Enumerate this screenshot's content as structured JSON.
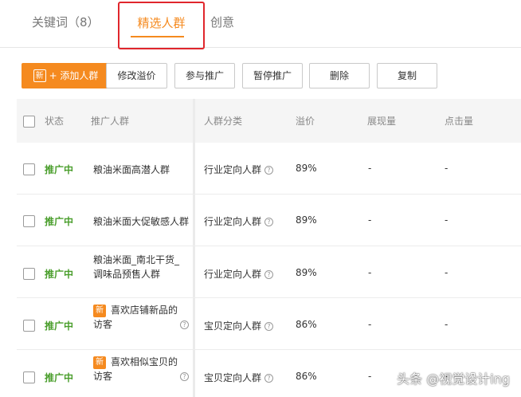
{
  "tabs": [
    {
      "label": "关键词（8）"
    },
    {
      "label": "精选人群"
    },
    {
      "label": "创意"
    }
  ],
  "toolbar": {
    "add_new_tag": "新",
    "add_label": "+ 添加人群",
    "modify_label": "修改溢价",
    "join_label": "参与推广",
    "pause_label": "暂停推广",
    "delete_label": "删除",
    "copy_label": "复制"
  },
  "table": {
    "headers": {
      "status": "状态",
      "crowd": "推广人群",
      "category": "人群分类",
      "premium": "溢价",
      "impressions": "展现量",
      "clicks": "点击量"
    },
    "help_icon": "?",
    "new_badge": "新",
    "rows": [
      {
        "status": "推广中",
        "name": "粮油米面高潜人群",
        "category": "行业定向人群",
        "premium": "89%",
        "impressions": "-",
        "clicks": "-"
      },
      {
        "status": "推广中",
        "name": "粮油米面大促敏感人群",
        "category": "行业定向人群",
        "premium": "89%",
        "impressions": "-",
        "clicks": "-"
      },
      {
        "status": "推广中",
        "name_line1": "粮油米面_南北干货_",
        "name_line2": "调味品预售人群",
        "category": "行业定向人群",
        "premium": "89%",
        "impressions": "-",
        "clicks": "-"
      },
      {
        "status": "推广中",
        "name_line1": "喜欢店铺新品的",
        "name_line2": "访客",
        "category": "宝贝定向人群",
        "premium": "86%",
        "impressions": "-",
        "clicks": "-"
      },
      {
        "status": "推广中",
        "name_line1": "喜欢相似宝贝的",
        "name_line2": "访客",
        "category": "宝贝定向人群",
        "premium": "86%",
        "impressions": "-",
        "clicks": "-"
      }
    ]
  },
  "watermark": "头条 @视觉设计ing",
  "colors": {
    "accent": "#f58a1f",
    "status_green": "#4a9e2c",
    "highlight_red": "#e0262c"
  }
}
